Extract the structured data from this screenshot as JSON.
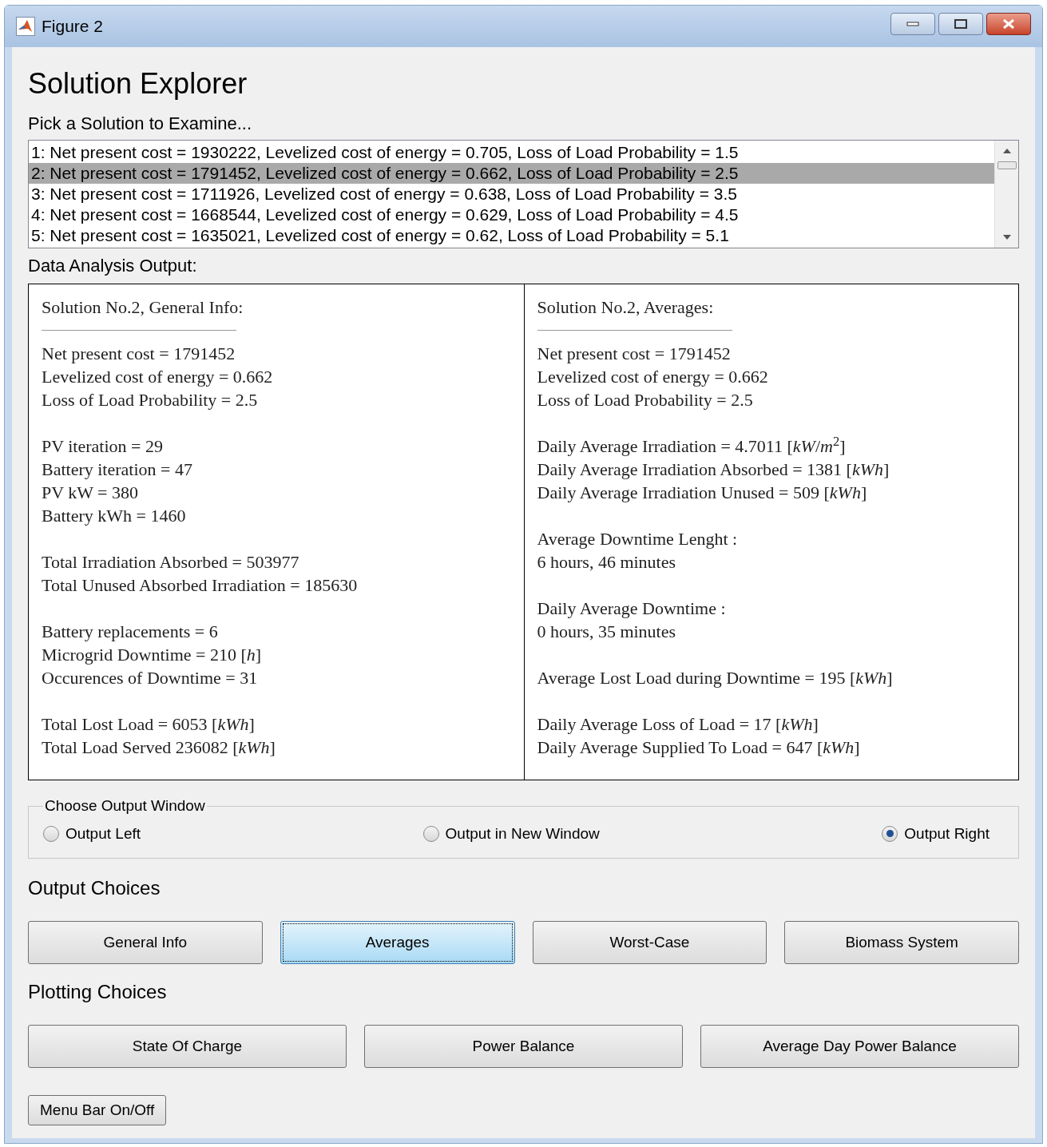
{
  "window": {
    "title": "Figure 2"
  },
  "heading": "Solution Explorer",
  "pick_label": "Pick a Solution to Examine...",
  "solutions": [
    {
      "text": "1: Net present cost = 1930222, Levelized cost of energy = 0.705, Loss of Load Probability = 1.5",
      "selected": false
    },
    {
      "text": "2: Net present cost = 1791452, Levelized cost of energy = 0.662, Loss of Load Probability = 2.5",
      "selected": true
    },
    {
      "text": "3: Net present cost = 1711926, Levelized cost of energy = 0.638, Loss of Load Probability = 3.5",
      "selected": false
    },
    {
      "text": "4: Net present cost = 1668544, Levelized cost of energy = 0.629, Loss of Load Probability = 4.5",
      "selected": false
    },
    {
      "text": "5: Net present cost = 1635021, Levelized cost of energy = 0.62, Loss of Load Probability = 5.1",
      "selected": false
    }
  ],
  "output_label": "Data Analysis Output:",
  "panels": [
    {
      "title": "Solution No.2, General Info:",
      "paragraphs": [
        [
          "Net present cost = 1791452",
          "Levelized cost of energy = 0.662",
          "Loss of Load Probability = 2.5"
        ],
        [
          "PV iteration = 29",
          "Battery iteration = 47",
          "PV kW = 380",
          "Battery kWh = 1460"
        ],
        [
          "Total Irradiation Absorbed = 503977",
          "Total Unused Absorbed Irradiation = 185630"
        ],
        [
          "Battery replacements = 6",
          "Microgrid Downtime = 210 [*h*]",
          "Occurences of Downtime = 31"
        ],
        [
          "Total Lost Load = 6053 [*kWh*]",
          "Total Load Served 236082 [*kWh*]"
        ]
      ]
    },
    {
      "title": "Solution No.2, Averages:",
      "paragraphs": [
        [
          "Net present cost = 1791452",
          "Levelized cost of energy = 0.662",
          "Loss of Load Probability = 2.5"
        ],
        [
          "Daily Average Irradiation = 4.7011 [*kW*/*m*$^{2}$]",
          "Daily Average Irradiation Absorbed = 1381 [*kWh*]",
          "Daily Average Irradiation Unused = 509 [*kWh*]"
        ],
        [
          "Average Downtime Lenght :",
          "6 hours, 46 minutes"
        ],
        [
          "Daily Average Downtime :",
          "0 hours, 35 minutes"
        ],
        [
          "Average Lost Load during Downtime = 195 [*kWh*]"
        ],
        [
          "Daily Average Loss of Load = 17 [*kWh*]",
          "Daily Average Supplied To Load = 647 [*kWh*]"
        ]
      ]
    }
  ],
  "output_window": {
    "legend": "Choose Output Window",
    "options": [
      {
        "label": "Output Left",
        "selected": false
      },
      {
        "label": "Output in New Window",
        "selected": false
      },
      {
        "label": "Output Right",
        "selected": true
      }
    ]
  },
  "output_choices": {
    "label": "Output Choices",
    "buttons": [
      {
        "label": "General Info",
        "selected": false
      },
      {
        "label": "Averages",
        "selected": true
      },
      {
        "label": "Worst-Case",
        "selected": false
      },
      {
        "label": "Biomass System",
        "selected": false
      }
    ]
  },
  "plotting_choices": {
    "label": "Plotting Choices",
    "buttons": [
      "State Of Charge",
      "Power Balance",
      "Average Day Power Balance"
    ]
  },
  "menu_button": "Menu Bar On/Off"
}
